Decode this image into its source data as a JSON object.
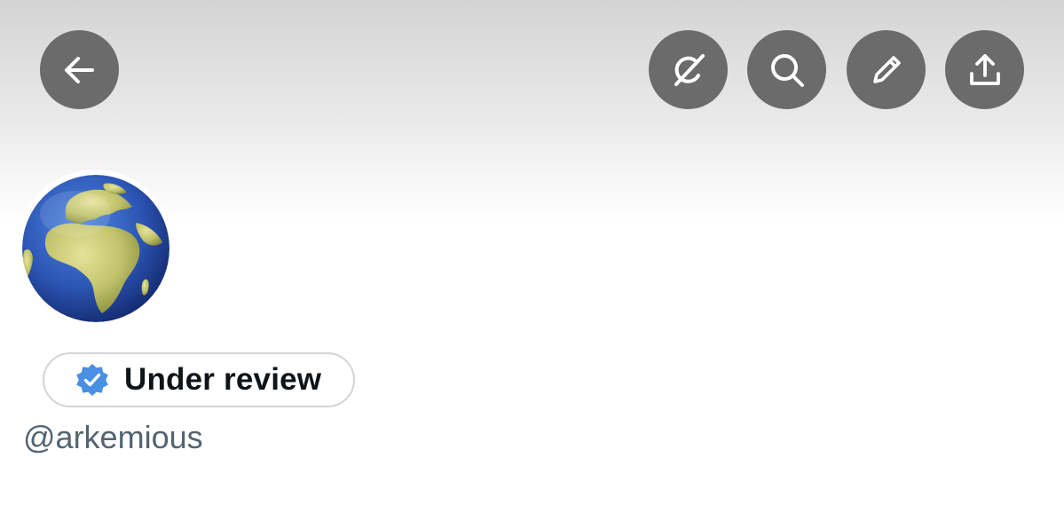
{
  "colors": {
    "header_top": "#d4d4d4",
    "button_bg": "#6b6b6b",
    "verified_blue": "#4a90e2",
    "badge_border": "#d2d4d6",
    "label_text": "#0f1419",
    "handle_text": "#536471"
  },
  "toolbar": {
    "back_icon": "arrow-left-icon",
    "actions": [
      {
        "icon": "grok-icon"
      },
      {
        "icon": "search-icon"
      },
      {
        "icon": "pencil-icon"
      },
      {
        "icon": "share-icon"
      }
    ]
  },
  "profile": {
    "avatar": "globe-europe-africa-icon",
    "badge": {
      "icon": "verified-badge-icon",
      "label": "Under review"
    },
    "handle": "@arkemious"
  }
}
